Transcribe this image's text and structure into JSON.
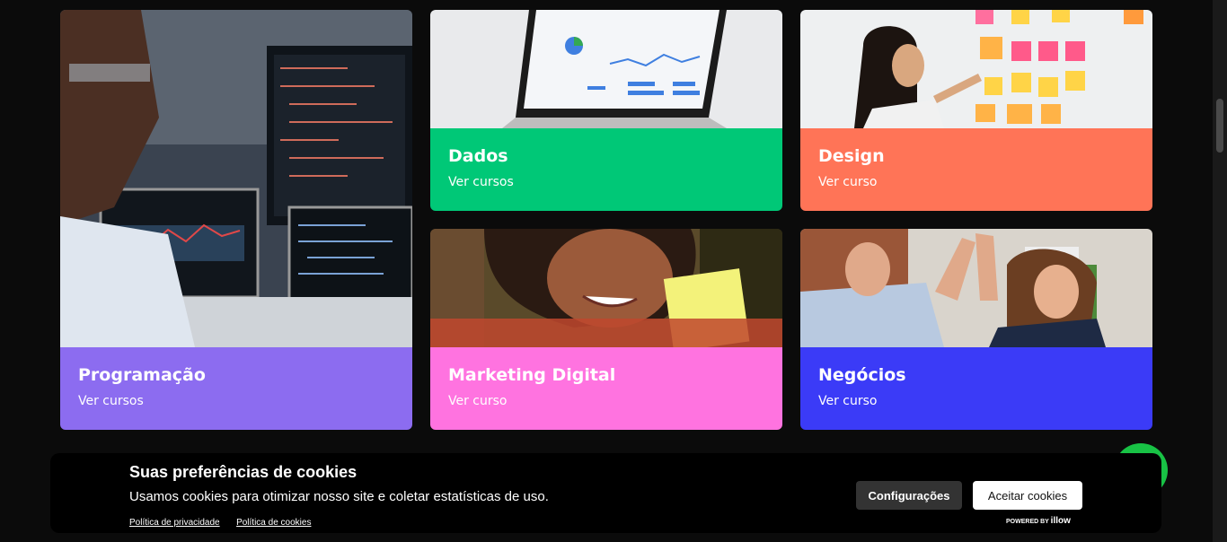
{
  "cards": [
    {
      "title": "Programação",
      "link": "Ver cursos",
      "color": "#8c6cf0"
    },
    {
      "title": "Dados",
      "link": "Ver cursos",
      "color": "#00c877"
    },
    {
      "title": "Design",
      "link": "Ver curso",
      "color": "#ff7457"
    },
    {
      "title": "Marketing Digital",
      "link": "Ver curso",
      "color": "#ff73e0"
    },
    {
      "title": "Negócios",
      "link": "Ver curso",
      "color": "#3b3bf7"
    }
  ],
  "cookie_banner": {
    "title": "Suas preferências de cookies",
    "text": "Usamos cookies para otimizar nosso site e coletar estatísticas de uso.",
    "privacy_link": "Política de privacidade",
    "cookies_link": "Política de cookies",
    "config_button": "Configurações",
    "accept_button": "Aceitar cookies",
    "powered_by": "POWERED BY",
    "brand": "illow"
  }
}
